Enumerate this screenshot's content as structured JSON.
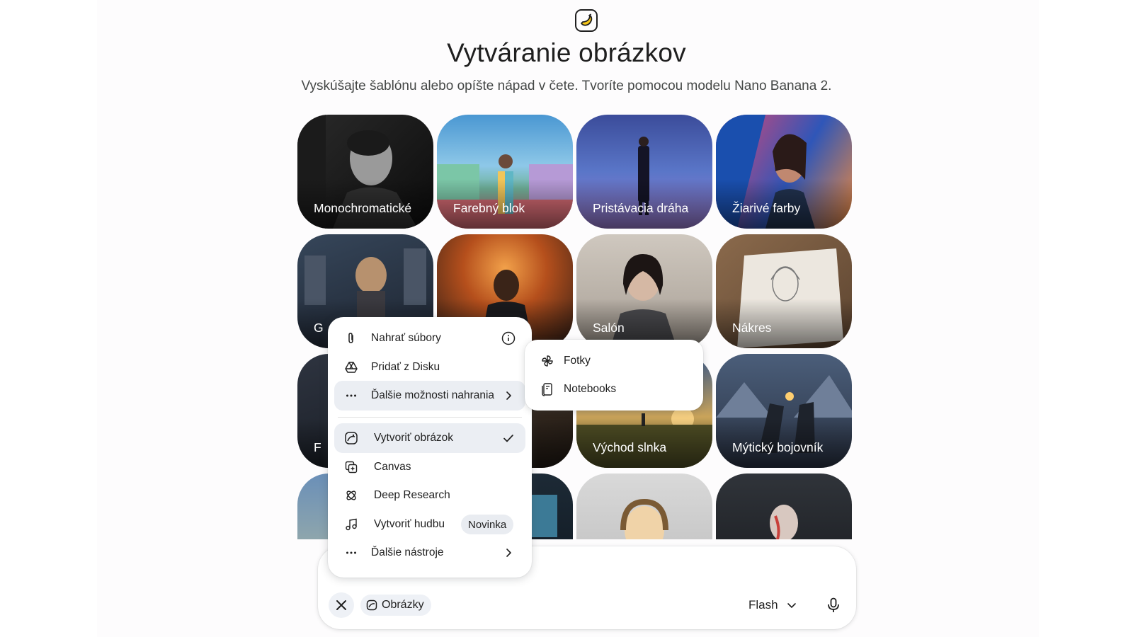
{
  "header": {
    "logo_icon": "banana-icon",
    "title": "Vytváranie obrázkov",
    "subtitle": "Vyskúšajte šablónu alebo opíšte nápad v čete. Tvoríte pomocou modelu Nano Banana 2."
  },
  "templates": [
    {
      "label": "Monochromatické"
    },
    {
      "label": "Farebný blok"
    },
    {
      "label": "Pristávacia dráha"
    },
    {
      "label": "Žiarivé farby"
    },
    {
      "label": "G"
    },
    {
      "label": ""
    },
    {
      "label": "Salón"
    },
    {
      "label": "Nákres"
    },
    {
      "label": "F"
    },
    {
      "label": ""
    },
    {
      "label": "Východ slnka"
    },
    {
      "label": "Mýtický bojovník"
    },
    {
      "label": ""
    },
    {
      "label": ""
    },
    {
      "label": ""
    },
    {
      "label": ""
    }
  ],
  "tools_menu": {
    "upload_files": "Nahrať súbory",
    "add_from_drive": "Pridať z Disku",
    "more_upload_options": "Ďalšie možnosti nahrania",
    "create_image": "Vytvoriť obrázok",
    "canvas": "Canvas",
    "deep_research": "Deep Research",
    "create_music": "Vytvoriť hudbu",
    "new_badge": "Novinka",
    "more_tools": "Ďalšie nástroje"
  },
  "upload_submenu": {
    "photos": "Fotky",
    "notebooks": "Notebooks"
  },
  "prompt_bar": {
    "chip_label": "Obrázky",
    "model_label": "Flash"
  }
}
